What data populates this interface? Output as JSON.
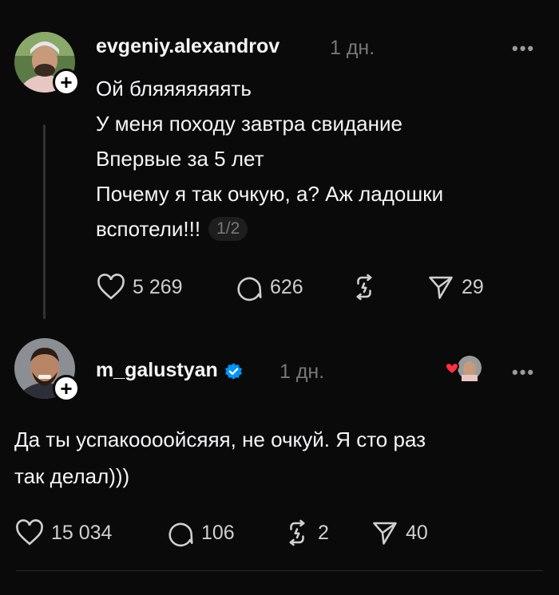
{
  "posts": [
    {
      "username": "evgeniy.alexandrov",
      "time": "1 дн.",
      "lines": [
        "Ой бляяяяяяять",
        "У меня походу завтра свидание",
        "Впервые за 5 лет",
        "Почему я так очкую, а? Аж ладошки",
        "вспотели!!!"
      ],
      "page_indicator": "1/2",
      "likes": "5 269",
      "comments": "626",
      "reposts": "",
      "shares": "29"
    },
    {
      "username": "m_galustyan",
      "time": "1 дн.",
      "verified": true,
      "lines": [
        "Да ты успакоооойсяяя, не очкуй. Я сто раз",
        "так делал)))"
      ],
      "likes": "15 034",
      "comments": "106",
      "reposts": "2",
      "shares": "40"
    }
  ],
  "icons": {
    "follow": "plus-icon",
    "more": "more-icon",
    "like": "heart-icon",
    "comment": "comment-icon",
    "repost": "repost-icon",
    "share": "send-icon",
    "verified": "verified-badge-icon"
  },
  "colors": {
    "background": "#0a0a0a",
    "text": "#f3f5f7",
    "muted": "#777777",
    "verified": "#0095f6",
    "heart_reaction": "#ff3040"
  },
  "ui": {
    "more_symbol": "•••",
    "follow_symbol": "+"
  }
}
